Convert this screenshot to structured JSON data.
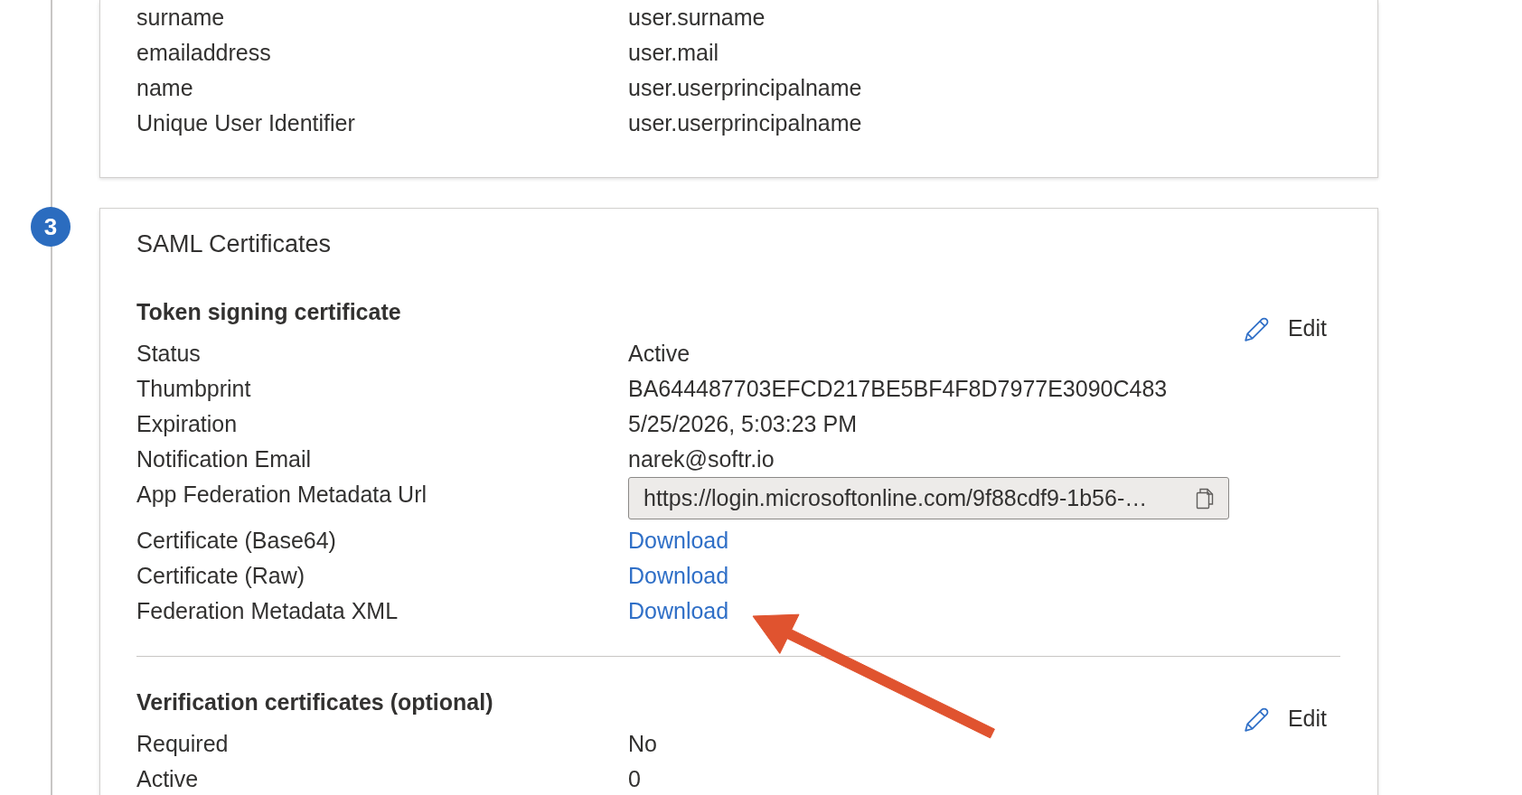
{
  "attributes_card": {
    "rows": [
      {
        "name": "surname",
        "value": "user.surname"
      },
      {
        "name": "emailaddress",
        "value": "user.mail"
      },
      {
        "name": "name",
        "value": "user.userprincipalname"
      },
      {
        "name": "Unique User Identifier",
        "value": "user.userprincipalname"
      }
    ]
  },
  "saml_certificates": {
    "step_number": "3",
    "title": "SAML Certificates",
    "subsections": [
      {
        "title": "Token signing certificate",
        "edit_label": "Edit",
        "rows": [
          {
            "kind": "text",
            "label": "Status",
            "value": "Active"
          },
          {
            "kind": "text",
            "label": "Thumbprint",
            "value": "BA644487703EFCD217BE5BF4F8D7977E3090C483"
          },
          {
            "kind": "text",
            "label": "Expiration",
            "value": "5/25/2026, 5:03:23 PM"
          },
          {
            "kind": "text",
            "label": "Notification Email",
            "value": "narek@softr.io"
          },
          {
            "kind": "url_field",
            "label": "App Federation Metadata Url",
            "value": "https://login.microsoftonline.com/9f88cdf9-1b56-…"
          },
          {
            "kind": "link",
            "label": "Certificate (Base64)",
            "value": "Download"
          },
          {
            "kind": "link",
            "label": "Certificate (Raw)",
            "value": "Download"
          },
          {
            "kind": "link",
            "label": "Federation Metadata XML",
            "value": "Download"
          }
        ]
      },
      {
        "title": "Verification certificates (optional)",
        "edit_label": "Edit",
        "rows": [
          {
            "kind": "text",
            "label": "Required",
            "value": "No"
          },
          {
            "kind": "text",
            "label": "Active",
            "value": "0"
          }
        ]
      }
    ]
  }
}
